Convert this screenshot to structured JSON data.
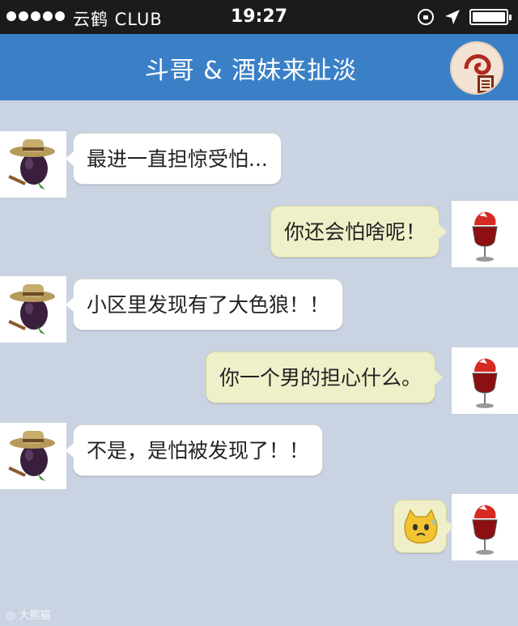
{
  "status_bar": {
    "carrier": "云鹤 CLUB",
    "time": "19:27",
    "signal_dots": 5,
    "icons": [
      "lock-rotation-icon",
      "location-arrow-icon",
      "battery-icon"
    ]
  },
  "header": {
    "title": "斗哥 & 酒妹来扯淡",
    "avatar_icon": "brand-logo-icon"
  },
  "messages": [
    {
      "side": "left",
      "sender_icon": "eggplant-hat-avatar",
      "text": "最进一直担惊受怕..."
    },
    {
      "side": "right",
      "sender_icon": "wine-glass-avatar",
      "text": "你还会怕啥呢！"
    },
    {
      "side": "left",
      "sender_icon": "eggplant-hat-avatar",
      "text": "小区里发现有了大色狼！！"
    },
    {
      "side": "right",
      "sender_icon": "wine-glass-avatar",
      "text": "你一个男的担心什么。"
    },
    {
      "side": "left",
      "sender_icon": "eggplant-hat-avatar",
      "text": "不是，是怕被发现了！！"
    },
    {
      "side": "right",
      "sender_icon": "wine-glass-avatar",
      "text": "",
      "sticker": "sweating-cat-emoji-icon"
    }
  ],
  "colors": {
    "nav_bar": "#3b80c6",
    "chat_background": "#c9d3e2",
    "incoming_bubble": "#ffffff",
    "outgoing_bubble": "#eff0c9"
  }
}
